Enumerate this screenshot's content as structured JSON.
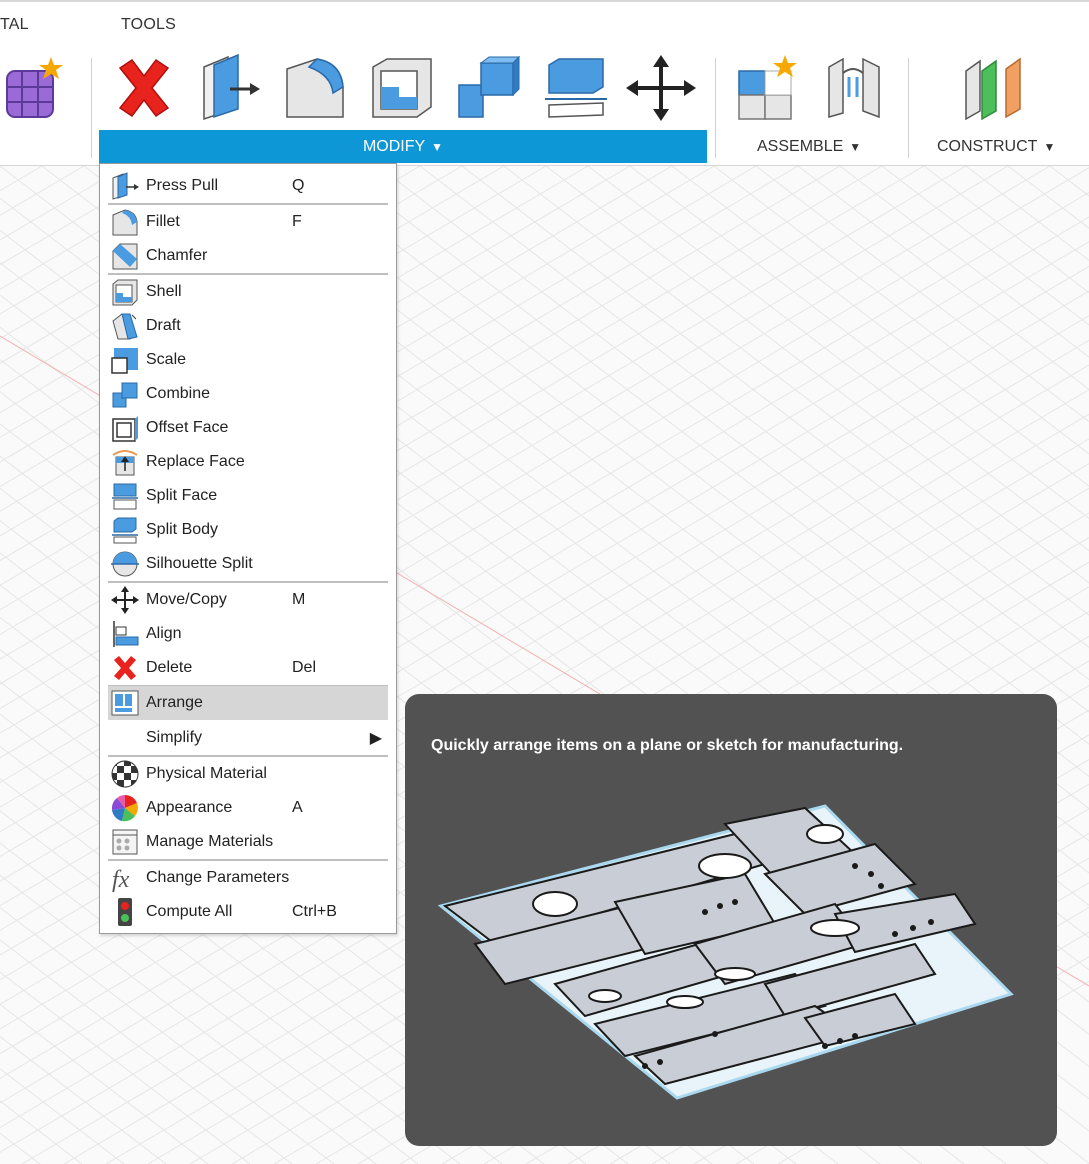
{
  "toolbar": {
    "tabs": {
      "left_partial": "TAL",
      "tools": "TOOLS"
    },
    "modify_label": "MODIFY",
    "assemble_label": "ASSEMBLE",
    "construct_label": "CONSTRUCT",
    "caret": "▼",
    "icons": [
      "create-form-icon",
      "delete-icon",
      "press-pull-icon",
      "fillet-icon",
      "shell-icon",
      "combine-icon",
      "split-body-icon",
      "move-copy-icon",
      "new-component-icon",
      "joint-icon",
      "construct-plane-icon"
    ]
  },
  "menu": {
    "items": [
      {
        "label": "Press Pull",
        "shortcut": "Q",
        "icon": "press-pull-icon"
      },
      {
        "label": "Fillet",
        "shortcut": "F",
        "icon": "fillet-icon"
      },
      {
        "label": "Chamfer",
        "shortcut": "",
        "icon": "chamfer-icon"
      },
      {
        "label": "Shell",
        "shortcut": "",
        "icon": "shell-icon"
      },
      {
        "label": "Draft",
        "shortcut": "",
        "icon": "draft-icon"
      },
      {
        "label": "Scale",
        "shortcut": "",
        "icon": "scale-icon"
      },
      {
        "label": "Combine",
        "shortcut": "",
        "icon": "combine-icon"
      },
      {
        "label": "Offset Face",
        "shortcut": "",
        "icon": "offset-face-icon"
      },
      {
        "label": "Replace Face",
        "shortcut": "",
        "icon": "replace-face-icon"
      },
      {
        "label": "Split Face",
        "shortcut": "",
        "icon": "split-face-icon"
      },
      {
        "label": "Split Body",
        "shortcut": "",
        "icon": "split-body-icon"
      },
      {
        "label": "Silhouette Split",
        "shortcut": "",
        "icon": "silhouette-split-icon"
      },
      {
        "label": "Move/Copy",
        "shortcut": "M",
        "icon": "move-copy-icon"
      },
      {
        "label": "Align",
        "shortcut": "",
        "icon": "align-icon"
      },
      {
        "label": "Delete",
        "shortcut": "Del",
        "icon": "delete-icon"
      },
      {
        "label": "Arrange",
        "shortcut": "",
        "icon": "arrange-icon",
        "highlighted": true
      },
      {
        "label": "Simplify",
        "shortcut": "",
        "icon": "",
        "submenu_arrow": "▶"
      },
      {
        "label": "Physical Material",
        "shortcut": "",
        "icon": "physical-material-icon"
      },
      {
        "label": "Appearance",
        "shortcut": "A",
        "icon": "appearance-icon"
      },
      {
        "label": "Manage Materials",
        "shortcut": "",
        "icon": "manage-materials-icon"
      },
      {
        "label": "Change Parameters",
        "shortcut": "",
        "icon": "change-parameters-icon"
      },
      {
        "label": "Compute All",
        "shortcut": "Ctrl+B",
        "icon": "compute-all-icon"
      }
    ]
  },
  "tooltip": {
    "text": "Quickly arrange items on a plane or sketch for manufacturing."
  },
  "colors": {
    "accent": "#0d97d6",
    "highlight": "#d6d6d6",
    "tooltip_bg": "#525252",
    "delete_red": "#e8221c",
    "icon_blue": "#4a9be0"
  }
}
